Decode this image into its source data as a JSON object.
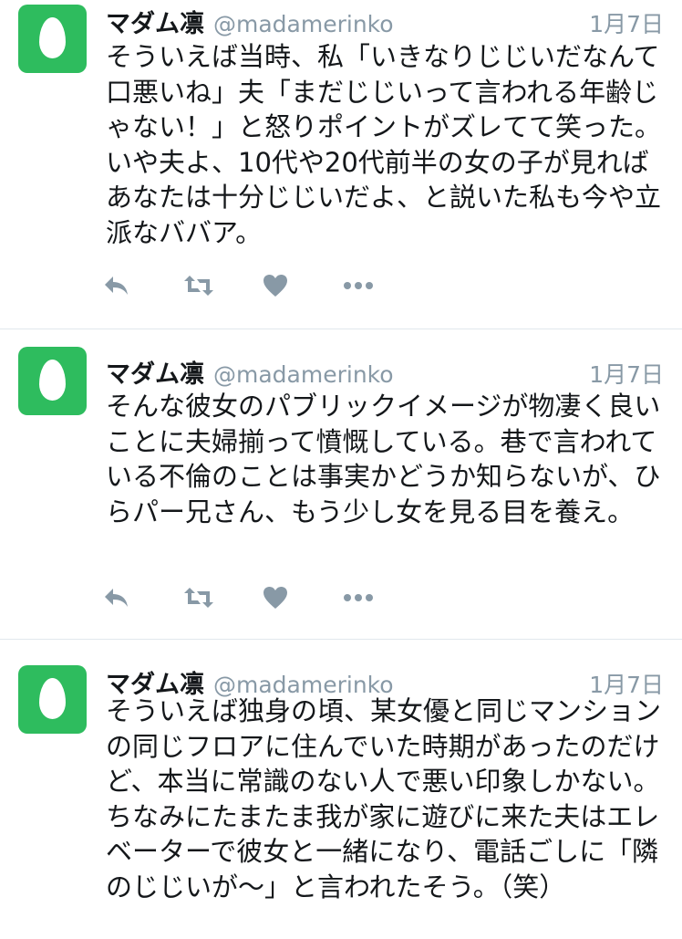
{
  "tweets": [
    {
      "display_name": "マダム凛",
      "handle": "@madamerinko",
      "date": "1月7日",
      "text": "そういえば当時、私「いきなりじじいだなんて口悪いね」夫「まだじじいって言われる年齢じゃない！」と怒りポイントがズレてて笑った。いや夫よ、10代や20代前半の女の子が見ればあなたは十分じじいだよ、と説いた私も今や立派なババア。"
    },
    {
      "display_name": "マダム凛",
      "handle": "@madamerinko",
      "date": "1月7日",
      "text": "そんな彼女のパブリックイメージが物凄く良いことに夫婦揃って憤慨している。巷で言われている不倫のことは事実かどうか知らないが、ひらパー兄さん、もう少し女を見る目を養え。"
    },
    {
      "display_name": "マダム凛",
      "handle": "@madamerinko",
      "date": "1月7日",
      "text": "そういえば独身の頃、某女優と同じマンションの同じフロアに住んでいた時期があったのだけど、本当に常識のない人で悪い印象しかない。ちなみにたまたま我が家に遊びに来た夫はエレベーターで彼女と一緒になり、電話ごしに「隣のじじいが〜」と言われたそう。（笑）"
    }
  ],
  "icons": {
    "avatar": "default-egg-avatar",
    "reply": "reply-icon",
    "retweet": "retweet-icon",
    "like": "heart-icon",
    "more": "more-icon"
  },
  "colors": {
    "avatar_bg": "#2ebc5e",
    "action_icon": "#8899a6",
    "meta_text": "#8899a6",
    "divider": "#e1e8ed"
  }
}
